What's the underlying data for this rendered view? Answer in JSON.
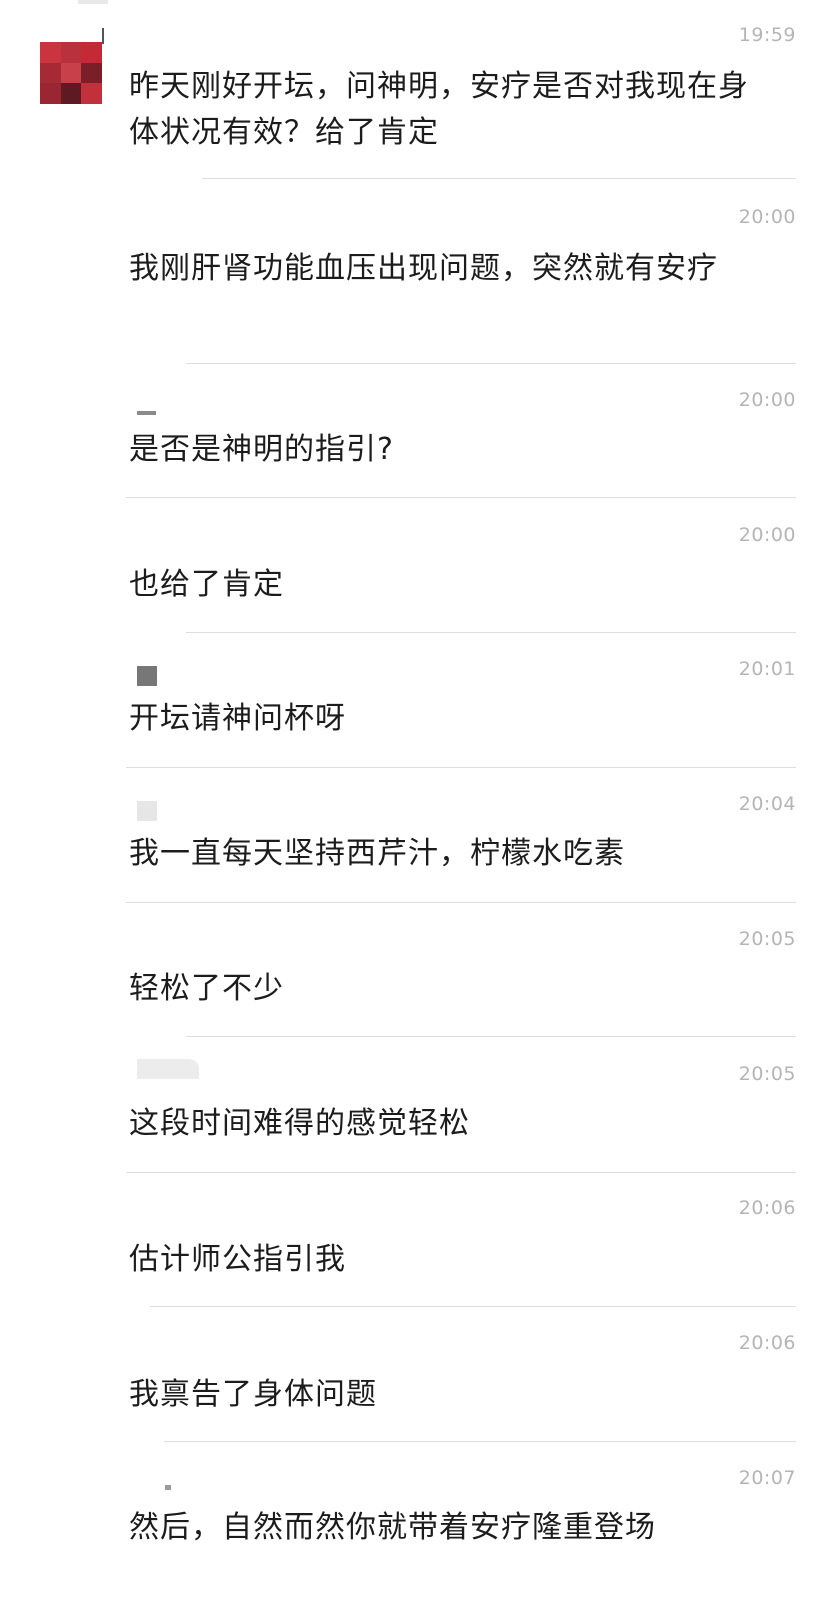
{
  "chat": {
    "messages": [
      {
        "time": "19:59",
        "text": "昨天刚好开坛，问神明，安疗是否对我现在身体状况有效？给了肯定"
      },
      {
        "time": "20:00",
        "text": "我刚肝肾功能血压出现问题，突然就有安疗"
      },
      {
        "time": "20:00",
        "text": "是否是神明的指引?"
      },
      {
        "time": "20:00",
        "text": "也给了肯定"
      },
      {
        "time": "20:01",
        "text": "开坛请神问杯呀"
      },
      {
        "time": "20:04",
        "text": "我一直每天坚持西芹汁，柠檬水吃素"
      },
      {
        "time": "20:05",
        "text": "轻松了不少"
      },
      {
        "time": "20:05",
        "text": "这段时间难得的感觉轻松"
      },
      {
        "time": "20:06",
        "text": "估计师公指引我"
      },
      {
        "time": "20:06",
        "text": "我禀告了身体问题"
      },
      {
        "time": "20:07",
        "text": "然后，自然而然你就带着安疗隆重登场"
      }
    ]
  },
  "avatar_colors": [
    "#c9343f",
    "#b8313c",
    "#c42a36",
    "#a62a35",
    "#c8404a",
    "#7a1f28",
    "#9b2633",
    "#5e1a22",
    "#c2303b"
  ],
  "colors": {
    "background": "#ffffff",
    "text": "#1c1c1c",
    "timestamp": "#b5b5b5",
    "divider": "#dedede"
  }
}
